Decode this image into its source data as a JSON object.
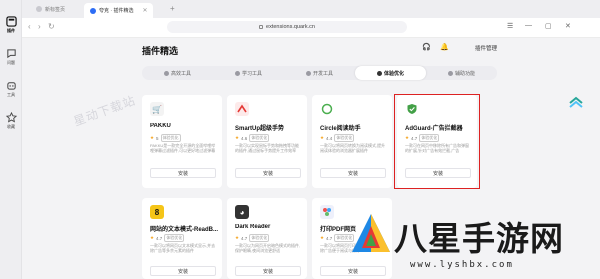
{
  "rail": {
    "items": [
      {
        "label": "插件",
        "icon": "puzzle-icon"
      },
      {
        "label": "问题",
        "icon": "chat-icon"
      },
      {
        "label": "工具",
        "icon": "robot-icon"
      },
      {
        "label": "收藏",
        "icon": "star-icon"
      }
    ]
  },
  "tabs": [
    {
      "label": "新标签页",
      "active": false
    },
    {
      "label": "夸克 · 插件精选",
      "active": true
    }
  ],
  "address": {
    "url": "extensions.quark.cn"
  },
  "page": {
    "title": "插件精选",
    "manage_label": "插件管理",
    "categories": [
      {
        "label": "高效工具",
        "active": false
      },
      {
        "label": "学习工具",
        "active": false
      },
      {
        "label": "开发工具",
        "active": false
      },
      {
        "label": "体验优化",
        "active": true
      },
      {
        "label": "辅助功能",
        "active": false
      }
    ],
    "watermark": "星动下载站"
  },
  "cards": [
    {
      "name": "PAKKU",
      "rating": "5",
      "tag": "体验优化",
      "desc": "PAKKU是一款完全开源的全面哔哩哔哩弹幕过滤插件,可以更好地过滤弹幕",
      "install": "安装",
      "icon": "pakku-icon",
      "color": "#888888"
    },
    {
      "name": "SmartUp超级手势",
      "rating": "4.6",
      "tag": "体验优化",
      "desc": "一款可以实现鼠标手势和拖拽等功能的插件,通过鼠标手势提升工作效率",
      "install": "安装",
      "icon": "smartup-icon",
      "color": "#e53935"
    },
    {
      "name": "Circle阅读助手",
      "rating": "4.4",
      "tag": "体验优化",
      "desc": "一款可以将网页转换为阅读模式,提升阅读体验的浏览器扩展插件",
      "install": "安装",
      "icon": "circle-icon",
      "color": "#4caf50"
    },
    {
      "name": "AdGuard-广告拦截器",
      "rating": "4.7",
      "tag": "体验优化",
      "desc": "一款可在网页中移除所有广告和弹窗的扩展,针对广告有效拦截,广告",
      "install": "安装",
      "icon": "adguard-shield-icon",
      "color": "#43a047"
    },
    {
      "name": "网站的文本模式-ReadB...",
      "rating": "4.7",
      "tag": "体验优化",
      "desc": "一款可以将网页以文本模式显示,并去除广告等多余元素的插件",
      "install": "安装",
      "icon": "textmode-icon",
      "color": "#f5c518"
    },
    {
      "name": "Dark Reader",
      "rating": "4.7",
      "tag": "体验优化",
      "desc": "一款可以为网页开启暗色模式的插件,保护眼睛,夜间浏览更舒适",
      "install": "安装",
      "icon": "darkreader-icon",
      "color": "#555555"
    },
    {
      "name": "打印PDF网页",
      "rating": "4.7",
      "tag": "体验优化",
      "desc": "一款可以将网页打印为PDF的扩展,去除广告便于阅读与保存",
      "install": "安装",
      "icon": "print-icon",
      "color": "#5c6bc0"
    }
  ],
  "brand": {
    "name": "八星手游网",
    "url": "www.lyshbx.com"
  }
}
